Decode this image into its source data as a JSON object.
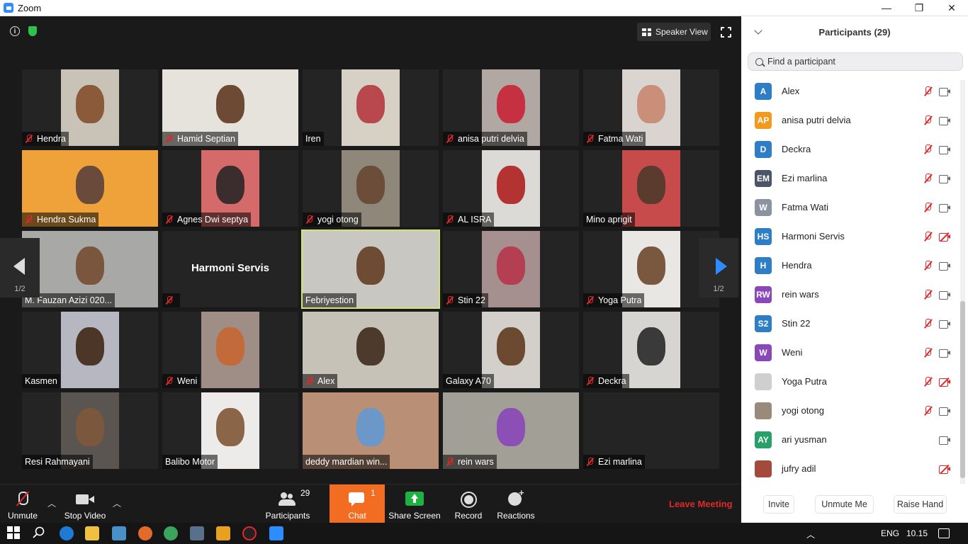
{
  "window": {
    "title": "Zoom",
    "minimize": "—",
    "maximize": "❐",
    "close": "✕"
  },
  "meeting": {
    "speaker_view_label": "Speaker View",
    "page_indicator": "1/2"
  },
  "tiles": [
    {
      "name": "Hendra",
      "muted": true,
      "bg": "#c9c2b6",
      "face": "#8a5a3b"
    },
    {
      "name": "Hamid Septian",
      "muted": true,
      "bg": "#e6e3dc",
      "face": "#6d4a33"
    },
    {
      "name": "Iren",
      "muted": false,
      "bg": "#d7d0c4",
      "face": "#b8474e"
    },
    {
      "name": "anisa putri delvia",
      "muted": true,
      "bg": "#b2a8a3",
      "face": "#c53140"
    },
    {
      "name": "Fatma Wati",
      "muted": true,
      "bg": "#d9d4cf",
      "face": "#c98f78"
    },
    {
      "name": "Hendra Sukma",
      "muted": true,
      "bg": "#f0a23a",
      "face": "#6a4a3a"
    },
    {
      "name": "Agnes Dwi septya",
      "muted": true,
      "bg": "#d56a6a",
      "face": "#3b2d2d"
    },
    {
      "name": "yogi otong",
      "muted": true,
      "bg": "#8f877a",
      "face": "#6b4d3a"
    },
    {
      "name": "AL ISRA",
      "muted": true,
      "bg": "#dcdad6",
      "face": "#b33232"
    },
    {
      "name": "Mino aprigit",
      "muted": false,
      "bg": "#c84b4b",
      "face": "#5a3b2d"
    },
    {
      "name": "M. Fauzan Azizi 020...",
      "muted": false,
      "bg": "#a8a9a6",
      "face": "#7a563e"
    },
    {
      "name": "Harmoni Servis",
      "muted": true,
      "bg": "",
      "face": ""
    },
    {
      "name": "Febriyestion",
      "muted": false,
      "bg": "#c9c7c2",
      "face": "#6e4c33"
    },
    {
      "name": "Stin 22",
      "muted": true,
      "bg": "#a68f8f",
      "face": "#b53f52"
    },
    {
      "name": "Yoga Putra",
      "muted": true,
      "bg": "#e8e7e4",
      "face": "#7a5840"
    },
    {
      "name": "Kasmen",
      "muted": false,
      "bg": "#b6b7c0",
      "face": "#4c3628"
    },
    {
      "name": "Weni",
      "muted": true,
      "bg": "#9e8e86",
      "face": "#c26a3a"
    },
    {
      "name": "Alex",
      "muted": true,
      "bg": "#c7c2b7",
      "face": "#4d3a2d"
    },
    {
      "name": "Galaxy A70",
      "muted": false,
      "bg": "#d3d0cb",
      "face": "#6c4a32"
    },
    {
      "name": "Deckra",
      "muted": true,
      "bg": "#d6d5d2",
      "face": "#3a3a3a"
    },
    {
      "name": "Resi Rahmayani",
      "muted": false,
      "bg": "#5a5550",
      "face": "#7b573e"
    },
    {
      "name": "Balibo Motor",
      "muted": false,
      "bg": "#ecebea",
      "face": "#8b6548"
    },
    {
      "name": "deddy mardian win...",
      "muted": false,
      "bg": "#b98f75",
      "face": "#6c97c9"
    },
    {
      "name": "rein wars",
      "muted": true,
      "bg": "#a29f97",
      "face": "#8c4fb6"
    },
    {
      "name": "Ezi marlina",
      "muted": true,
      "bg": "",
      "face": ""
    }
  ],
  "toolbar": {
    "unmute": "Unmute",
    "stop_video": "Stop Video",
    "participants": "Participants",
    "participants_count": "29",
    "chat": "Chat",
    "chat_badge": "1",
    "share_screen": "Share Screen",
    "record": "Record",
    "reactions": "Reactions",
    "leave": "Leave Meeting"
  },
  "panel": {
    "title": "Participants (29)",
    "search_placeholder": "Find a participant",
    "participants": [
      {
        "initials": "A",
        "name": "Alex",
        "color": "#2d7ec7",
        "mic_muted": true,
        "cam_off": false
      },
      {
        "initials": "AP",
        "name": "anisa putri delvia",
        "color": "#f39a1e",
        "mic_muted": true,
        "cam_off": false
      },
      {
        "initials": "D",
        "name": "Deckra",
        "color": "#2d7ec7",
        "mic_muted": true,
        "cam_off": false
      },
      {
        "initials": "EM",
        "name": "Ezi marlina",
        "color": "#4a5667",
        "mic_muted": true,
        "cam_off": false
      },
      {
        "initials": "W",
        "name": "Fatma Wati",
        "color": "#8a94a0",
        "mic_muted": true,
        "cam_off": false
      },
      {
        "initials": "HS",
        "name": "Harmoni Servis",
        "color": "#2d7ec7",
        "mic_muted": true,
        "cam_off": true
      },
      {
        "initials": "H",
        "name": "Hendra",
        "color": "#2d7ec7",
        "mic_muted": true,
        "cam_off": false
      },
      {
        "initials": "RW",
        "name": "rein wars",
        "color": "#8a47b8",
        "mic_muted": true,
        "cam_off": false
      },
      {
        "initials": "S2",
        "name": "Stin 22",
        "color": "#2d7ec7",
        "mic_muted": true,
        "cam_off": false
      },
      {
        "initials": "W",
        "name": "Weni",
        "color": "#8a47b8",
        "mic_muted": true,
        "cam_off": false
      },
      {
        "initials": "",
        "name": "Yoga Putra",
        "color": "#cfcfcf",
        "mic_muted": true,
        "cam_off": true
      },
      {
        "initials": "",
        "name": "yogi otong",
        "color": "#9a8a7a",
        "mic_muted": true,
        "cam_off": false
      },
      {
        "initials": "AY",
        "name": "ari yusman",
        "color": "#27a06a",
        "mic_muted": false,
        "cam_off": false
      },
      {
        "initials": "",
        "name": "jufry adil",
        "color": "#a4493b",
        "mic_muted": false,
        "cam_off": true
      }
    ],
    "invite": "Invite",
    "unmute_me": "Unmute Me",
    "raise_hand": "Raise Hand"
  },
  "taskbar": {
    "language": "ENG",
    "time": "10.15"
  }
}
